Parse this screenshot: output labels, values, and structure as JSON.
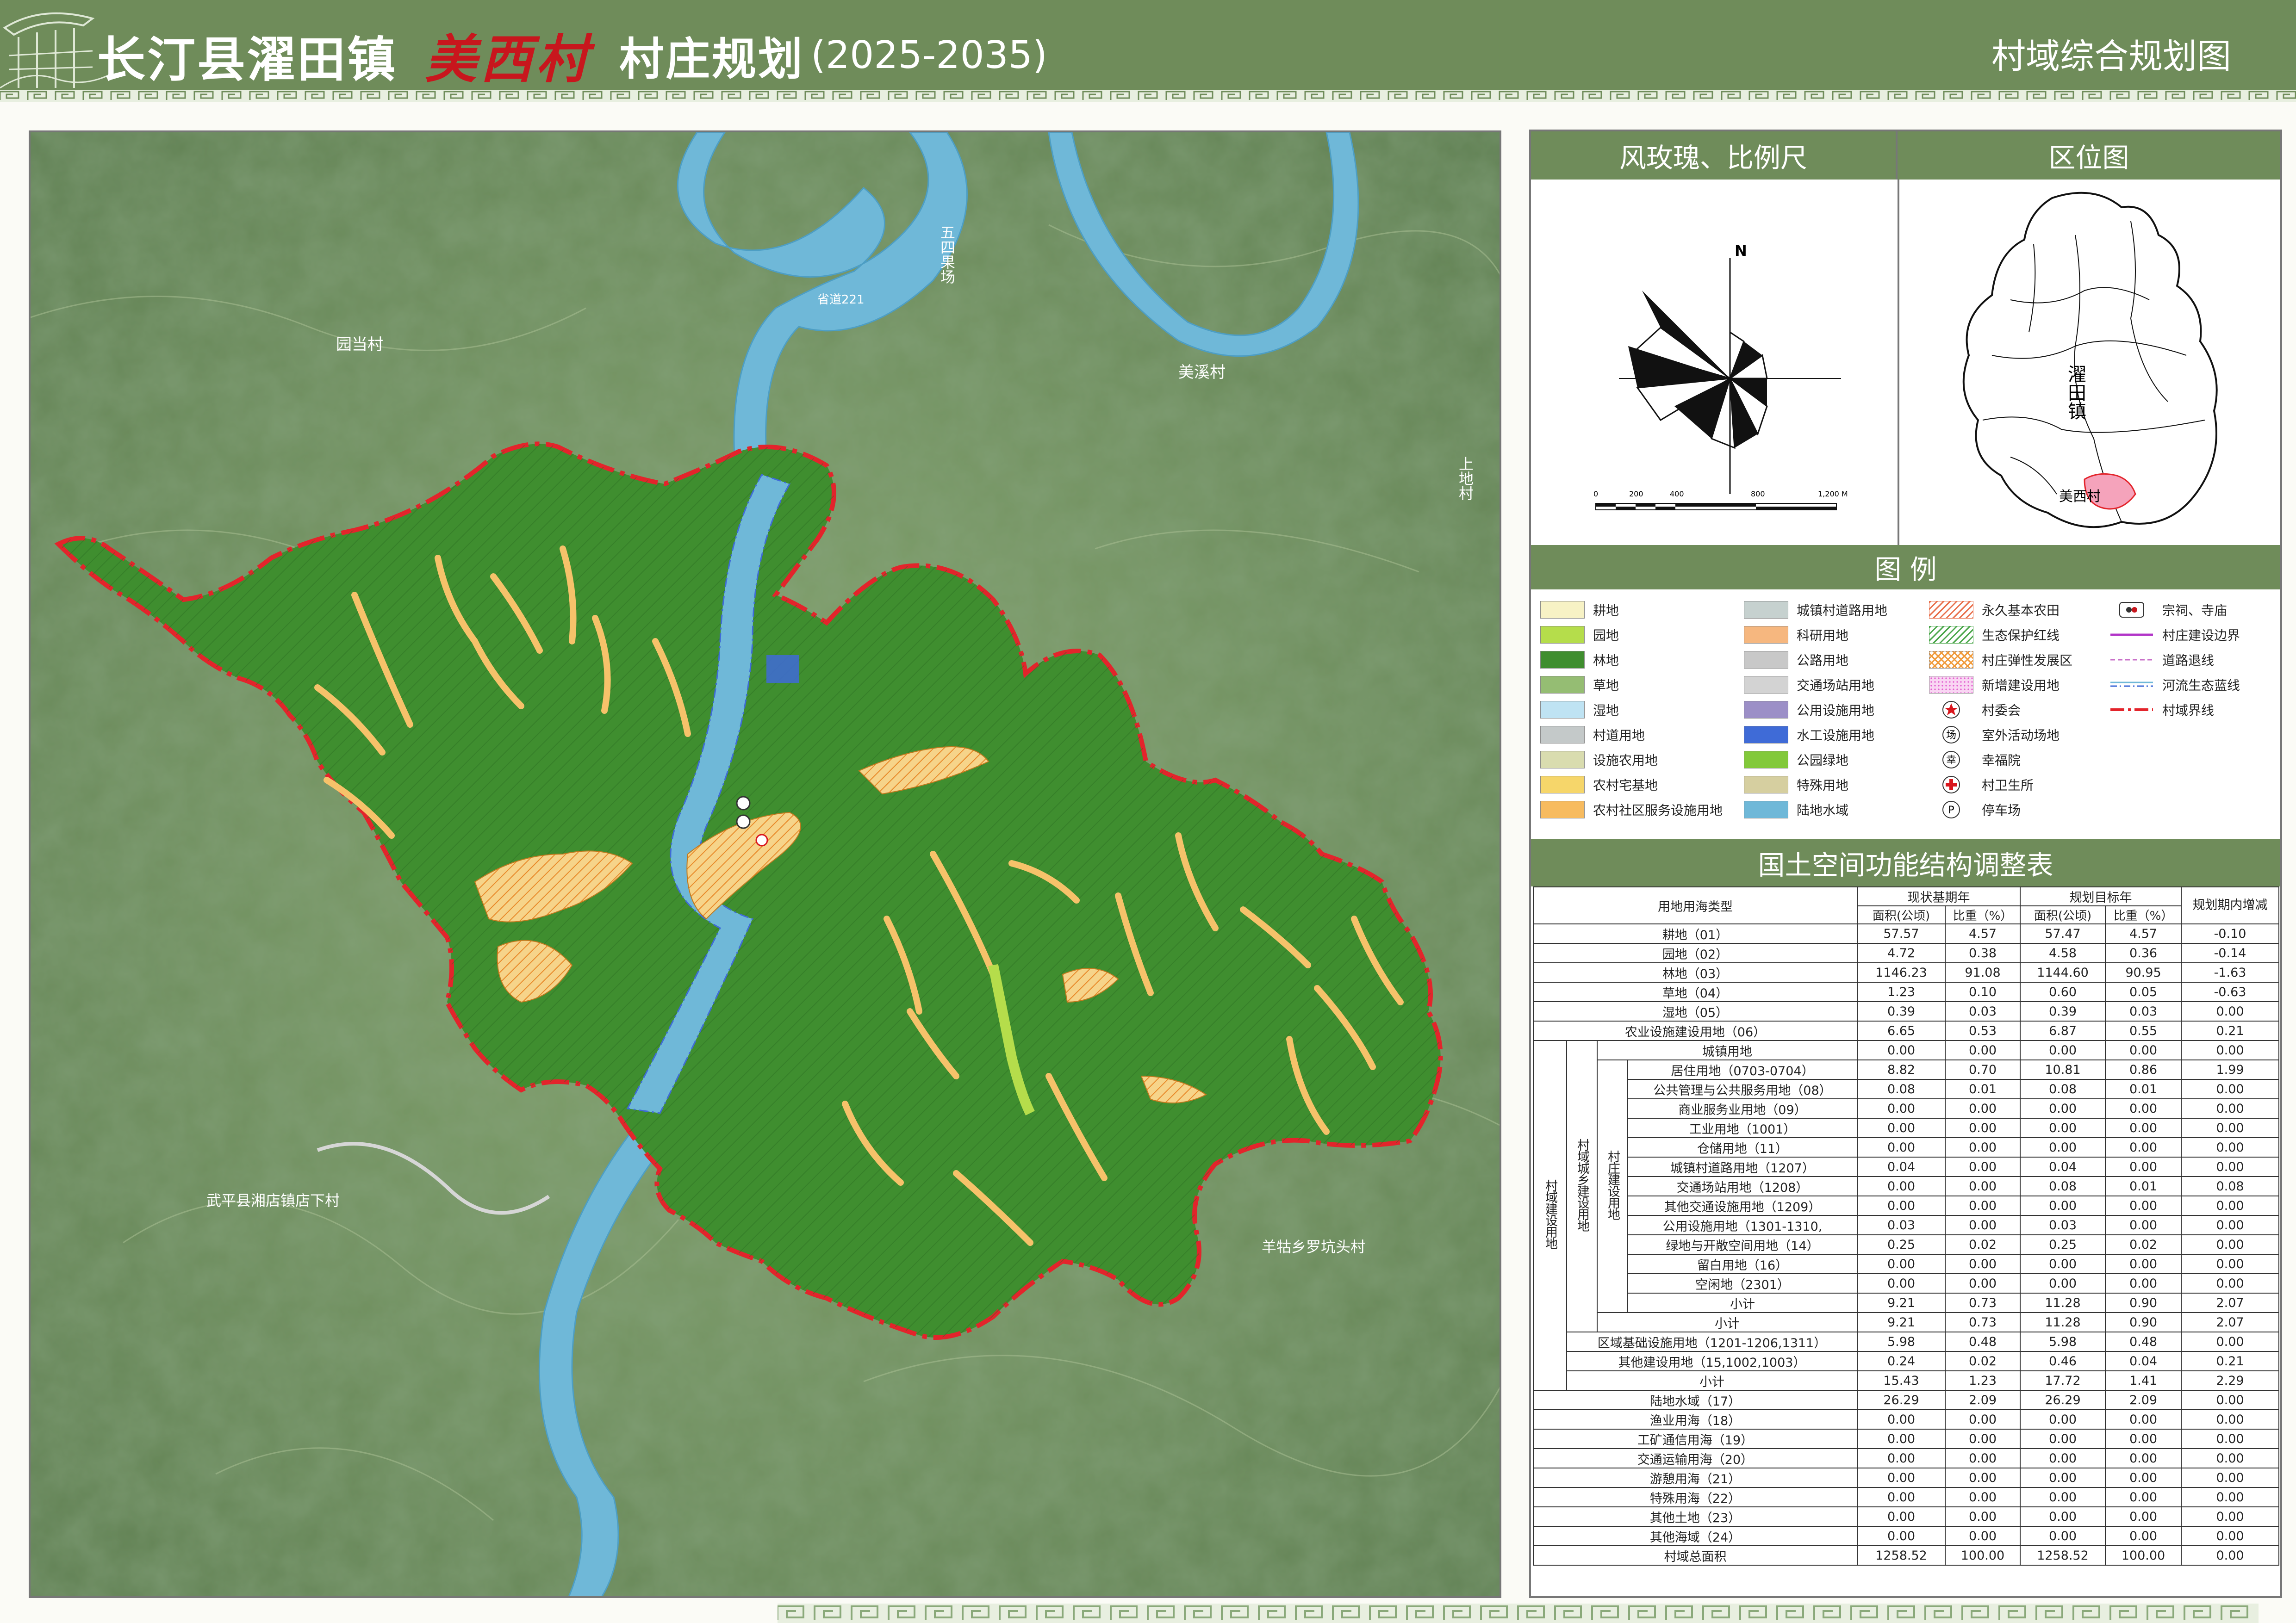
{
  "header": {
    "title_county": "长汀县濯田镇",
    "title_village": "美西村",
    "title_plan": "村庄规划",
    "title_years": "(2025-2035)",
    "subtitle": "村域综合规划图"
  },
  "colors": {
    "header_bg": "#6f8c5a",
    "forest": "#3f8e2f",
    "river": "#6fb8d8",
    "boundary": "#e3242b",
    "village_land": "#f3c36c"
  },
  "map": {
    "labels": {
      "dangcun": "园当村",
      "meixi": "美溪村",
      "shangtian": "上地村",
      "road_name": "省道221",
      "wuping": "武平县湘店镇店下村",
      "luoshi": "羊牯乡罗坑头村",
      "river_village": "五四果场"
    }
  },
  "right_panel": {
    "compass_title": "风玫瑰、比例尺",
    "location_title": "区位图",
    "north": "N",
    "scale_ticks": [
      "0",
      "200",
      "400",
      "800",
      "1,200 M"
    ],
    "town_name": "濯田镇",
    "village_name": "美西村",
    "legend_title": "图  例",
    "table_title": "国土空间功能结构调整表"
  },
  "legend": [
    {
      "label": "耕地",
      "color": "#f7f2c5",
      "kind": "fill"
    },
    {
      "label": "园地",
      "color": "#b5dd4b",
      "kind": "fill"
    },
    {
      "label": "林地",
      "color": "#3f8e2f",
      "kind": "fill"
    },
    {
      "label": "草地",
      "color": "#95bd73",
      "kind": "fill"
    },
    {
      "label": "湿地",
      "color": "#bfe3f3",
      "kind": "fill"
    },
    {
      "label": "村道用地",
      "color": "#c4c9c9",
      "kind": "fill"
    },
    {
      "label": "设施农用地",
      "color": "#d9dcaf",
      "kind": "fill"
    },
    {
      "label": "农村宅基地",
      "color": "#f6d66a",
      "kind": "fill"
    },
    {
      "label": "农村社区服务设施用地",
      "color": "#f7bb5f",
      "kind": "fill"
    },
    {
      "label": "城镇村道路用地",
      "color": "#c6d1cf",
      "kind": "fill"
    },
    {
      "label": "科研用地",
      "color": "#f6b77f",
      "kind": "fill"
    },
    {
      "label": "公路用地",
      "color": "#c8c8c8",
      "kind": "fill"
    },
    {
      "label": "交通场站用地",
      "color": "#d3d3d3",
      "kind": "fill"
    },
    {
      "label": "公用设施用地",
      "color": "#9c8fc7",
      "kind": "fill"
    },
    {
      "label": "水工设施用地",
      "color": "#3f6bd7",
      "kind": "fill"
    },
    {
      "label": "公园绿地",
      "color": "#82c93a",
      "kind": "fill"
    },
    {
      "label": "特殊用地",
      "color": "#d6cfa0",
      "kind": "fill"
    },
    {
      "label": "陆地水域",
      "color": "#6fb8d8",
      "kind": "fill"
    },
    {
      "label": "永久基本农田",
      "color": "#e86f4b",
      "kind": "hatch"
    },
    {
      "label": "生态保护红线",
      "color": "#4aa64a",
      "kind": "hatch"
    },
    {
      "label": "村庄弹性发展区",
      "color": "#f09a3a",
      "kind": "cross"
    },
    {
      "label": "新增建设用地",
      "color": "#e461d0",
      "kind": "dots"
    },
    {
      "label": "村委会",
      "color": "#d9161d",
      "kind": "star"
    },
    {
      "label": "室外活动场地",
      "color": "#333333",
      "kind": "circle-text",
      "glyph": "场"
    },
    {
      "label": "幸福院",
      "color": "#333333",
      "kind": "circle-text",
      "glyph": "幸"
    },
    {
      "label": "村卫生所",
      "color": "#d9161d",
      "kind": "cross-icon"
    },
    {
      "label": "停车场",
      "color": "#333333",
      "kind": "circle-text",
      "glyph": "P"
    },
    {
      "label": "宗祠、寺庙",
      "color": "#333333",
      "kind": "temple"
    },
    {
      "label": "村庄建设边界",
      "color": "#b234c8",
      "kind": "line-solid"
    },
    {
      "label": "道路退线",
      "color": "#c86ec8",
      "kind": "line-dash"
    },
    {
      "label": "河流生态蓝线",
      "color": "#3f6bd7",
      "kind": "line-dashdot"
    },
    {
      "label": "村域界线",
      "color": "#e3242b",
      "kind": "line-boundary"
    }
  ],
  "table": {
    "header": {
      "type": "用地用海类型",
      "base_year": "现状基期年",
      "target_year": "规划目标年",
      "change": "规划期内增减",
      "area": "面积(公顷)",
      "ratio": "比重（%）"
    },
    "groups": {
      "g1": "村域建设用地",
      "g2": "村域城乡建设用地",
      "g3": "村庄建设用地"
    },
    "rows": [
      {
        "name": "耕地（01）",
        "a1": "57.57",
        "r1": "4.57",
        "a2": "57.47",
        "r2": "4.57",
        "d": "-0.10"
      },
      {
        "name": "园地（02）",
        "a1": "4.72",
        "r1": "0.38",
        "a2": "4.58",
        "r2": "0.36",
        "d": "-0.14"
      },
      {
        "name": "林地（03）",
        "a1": "1146.23",
        "r1": "91.08",
        "a2": "1144.60",
        "r2": "90.95",
        "d": "-1.63"
      },
      {
        "name": "草地（04）",
        "a1": "1.23",
        "r1": "0.10",
        "a2": "0.60",
        "r2": "0.05",
        "d": "-0.63"
      },
      {
        "name": "湿地（05）",
        "a1": "0.39",
        "r1": "0.03",
        "a2": "0.39",
        "r2": "0.03",
        "d": "0.00"
      },
      {
        "name": "农业设施建设用地（06）",
        "a1": "6.65",
        "r1": "0.53",
        "a2": "6.87",
        "r2": "0.55",
        "d": "0.21"
      },
      {
        "name": "城镇用地",
        "a1": "0.00",
        "r1": "0.00",
        "a2": "0.00",
        "r2": "0.00",
        "d": "0.00"
      },
      {
        "name": "居住用地（0703-0704）",
        "a1": "8.82",
        "r1": "0.70",
        "a2": "10.81",
        "r2": "0.86",
        "d": "1.99"
      },
      {
        "name": "公共管理与公共服务用地（08）",
        "a1": "0.08",
        "r1": "0.01",
        "a2": "0.08",
        "r2": "0.01",
        "d": "0.00"
      },
      {
        "name": "商业服务业用地（09）",
        "a1": "0.00",
        "r1": "0.00",
        "a2": "0.00",
        "r2": "0.00",
        "d": "0.00"
      },
      {
        "name": "工业用地（1001）",
        "a1": "0.00",
        "r1": "0.00",
        "a2": "0.00",
        "r2": "0.00",
        "d": "0.00"
      },
      {
        "name": "仓储用地（11）",
        "a1": "0.00",
        "r1": "0.00",
        "a2": "0.00",
        "r2": "0.00",
        "d": "0.00"
      },
      {
        "name": "城镇村道路用地（1207）",
        "a1": "0.04",
        "r1": "0.00",
        "a2": "0.04",
        "r2": "0.00",
        "d": "0.00"
      },
      {
        "name": "交通场站用地（1208）",
        "a1": "0.00",
        "r1": "0.00",
        "a2": "0.08",
        "r2": "0.01",
        "d": "0.08"
      },
      {
        "name": "其他交通设施用地（1209）",
        "a1": "0.00",
        "r1": "0.00",
        "a2": "0.00",
        "r2": "0.00",
        "d": "0.00"
      },
      {
        "name": "公用设施用地（1301-1310,",
        "a1": "0.03",
        "r1": "0.00",
        "a2": "0.03",
        "r2": "0.00",
        "d": "0.00"
      },
      {
        "name": "绿地与开敞空间用地（14）",
        "a1": "0.25",
        "r1": "0.02",
        "a2": "0.25",
        "r2": "0.02",
        "d": "0.00"
      },
      {
        "name": "留白用地（16）",
        "a1": "0.00",
        "r1": "0.00",
        "a2": "0.00",
        "r2": "0.00",
        "d": "0.00"
      },
      {
        "name": "空闲地（2301）",
        "a1": "0.00",
        "r1": "0.00",
        "a2": "0.00",
        "r2": "0.00",
        "d": "0.00"
      },
      {
        "name": "小计",
        "a1": "9.21",
        "r1": "0.73",
        "a2": "11.28",
        "r2": "0.90",
        "d": "2.07"
      },
      {
        "name": "小计",
        "a1": "9.21",
        "r1": "0.73",
        "a2": "11.28",
        "r2": "0.90",
        "d": "2.07"
      },
      {
        "name": "区域基础设施用地（1201-1206,1311）",
        "a1": "5.98",
        "r1": "0.48",
        "a2": "5.98",
        "r2": "0.48",
        "d": "0.00"
      },
      {
        "name": "其他建设用地（15,1002,1003）",
        "a1": "0.24",
        "r1": "0.02",
        "a2": "0.46",
        "r2": "0.04",
        "d": "0.21"
      },
      {
        "name": "小计",
        "a1": "15.43",
        "r1": "1.23",
        "a2": "17.72",
        "r2": "1.41",
        "d": "2.29"
      },
      {
        "name": "陆地水域（17）",
        "a1": "26.29",
        "r1": "2.09",
        "a2": "26.29",
        "r2": "2.09",
        "d": "0.00"
      },
      {
        "name": "渔业用海（18）",
        "a1": "0.00",
        "r1": "0.00",
        "a2": "0.00",
        "r2": "0.00",
        "d": "0.00"
      },
      {
        "name": "工矿通信用海（19）",
        "a1": "0.00",
        "r1": "0.00",
        "a2": "0.00",
        "r2": "0.00",
        "d": "0.00"
      },
      {
        "name": "交通运输用海（20）",
        "a1": "0.00",
        "r1": "0.00",
        "a2": "0.00",
        "r2": "0.00",
        "d": "0.00"
      },
      {
        "name": "游憩用海（21）",
        "a1": "0.00",
        "r1": "0.00",
        "a2": "0.00",
        "r2": "0.00",
        "d": "0.00"
      },
      {
        "name": "特殊用海（22）",
        "a1": "0.00",
        "r1": "0.00",
        "a2": "0.00",
        "r2": "0.00",
        "d": "0.00"
      },
      {
        "name": "其他土地（23）",
        "a1": "0.00",
        "r1": "0.00",
        "a2": "0.00",
        "r2": "0.00",
        "d": "0.00"
      },
      {
        "name": "其他海域（24）",
        "a1": "0.00",
        "r1": "0.00",
        "a2": "0.00",
        "r2": "0.00",
        "d": "0.00"
      },
      {
        "name": "村域总面积",
        "a1": "1258.52",
        "r1": "100.00",
        "a2": "1258.52",
        "r2": "100.00",
        "d": "0.00"
      }
    ]
  }
}
